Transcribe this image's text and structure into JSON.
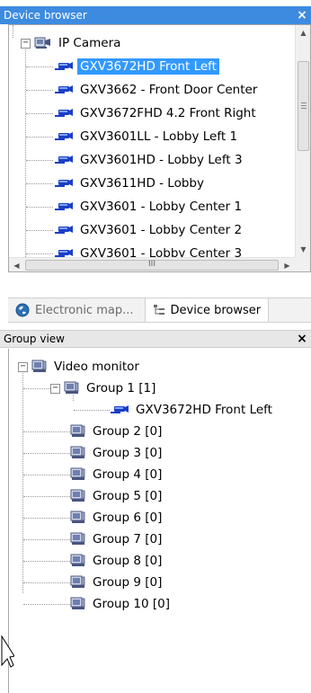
{
  "device_browser": {
    "title": "Device browser",
    "close_label": "×",
    "root": {
      "label": "IP Camera",
      "expander": "−"
    },
    "cameras": [
      {
        "label": "GXV3672HD Front Left",
        "selected": true
      },
      {
        "label": "GXV3662 - Front Door Center",
        "selected": false
      },
      {
        "label": "GXV3672FHD 4.2 Front Right",
        "selected": false
      },
      {
        "label": "GXV3601LL - Lobby Left 1",
        "selected": false
      },
      {
        "label": "GXV3601HD - Lobby Left 3",
        "selected": false
      },
      {
        "label": "GXV3611HD - Lobby",
        "selected": false
      },
      {
        "label": "GXV3601 - Lobby Center 1",
        "selected": false
      },
      {
        "label": "GXV3601 - Lobby Center 2",
        "selected": false
      },
      {
        "label": "GXV3601 - Lobby Center 3",
        "selected": false
      }
    ],
    "hscroll_grip": "III"
  },
  "tabs": [
    {
      "label": "Electronic map...",
      "icon": "globe-icon",
      "active": false
    },
    {
      "label": "Device browser",
      "icon": "tree-icon",
      "active": true
    }
  ],
  "group_view": {
    "title": "Group view",
    "close_label": "×",
    "root": {
      "label": "Video monitor",
      "expander": "−"
    },
    "group1": {
      "label": "Group 1 [1]",
      "expander": "−",
      "child": "GXV3672HD Front Left"
    },
    "groups": [
      "Group 2 [0]",
      "Group 3 [0]",
      "Group 4 [0]",
      "Group 5 [0]",
      "Group 6 [0]",
      "Group 7 [0]",
      "Group 8 [0]",
      "Group 9 [0]",
      "Group 10 [0]"
    ]
  },
  "colors": {
    "accent": "#3d8be0",
    "selection": "#3399ff",
    "camera_icon": "#1a3fc7"
  }
}
